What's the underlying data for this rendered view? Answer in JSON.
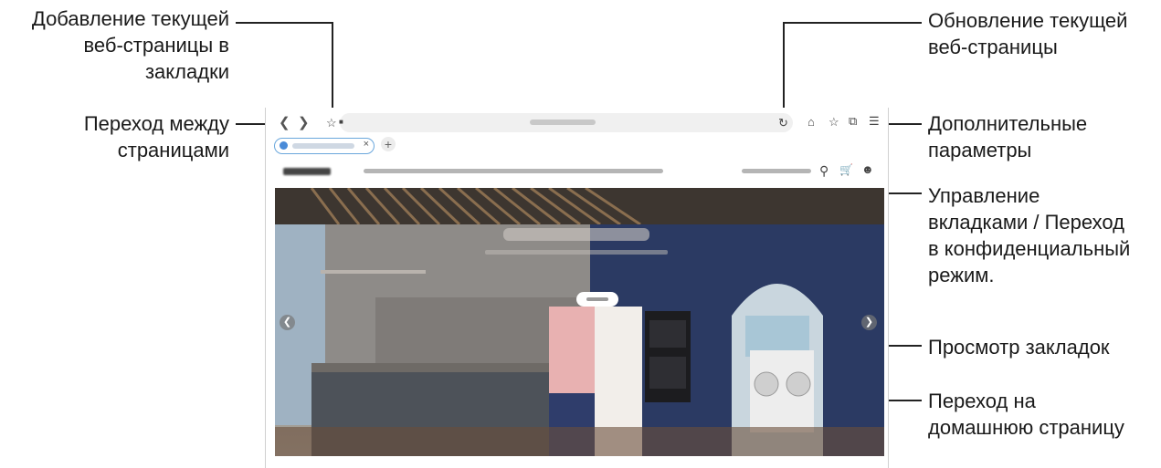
{
  "annotations": {
    "add_bookmark": [
      "Добавление текущей",
      "веб-страницы в",
      "закладки"
    ],
    "page_nav": [
      "Переход между",
      "страницами"
    ],
    "refresh": [
      "Обновление текущей",
      "веб-страницы"
    ],
    "more_options": [
      "Дополнительные",
      "параметры"
    ],
    "tabs_manage": [
      "Управление",
      "вкладками / Переход",
      "в конфиденциальный",
      "режим."
    ],
    "view_bookmarks": [
      "Просмотр закладок"
    ],
    "home": [
      "Переход на",
      "домашнюю страницу"
    ]
  },
  "browser": {
    "back_icon": "chevron-left-icon",
    "forward_icon": "chevron-right-icon",
    "bookmark_icon": "star-icon",
    "refresh_icon": "refresh-icon",
    "home_icon": "home-icon",
    "bookmarks_icon": "star-icon",
    "tabs_icon": "tabs-icon",
    "menu_icon": "menu-icon",
    "new_tab_glyph": "+",
    "tab_close_glyph": "×"
  },
  "colors": {
    "accent": "#6aa7dc",
    "wall_navy": "#2b3a63",
    "cabinet_gray": "#4d5259",
    "fridge_pink": "#e8b1b1"
  }
}
